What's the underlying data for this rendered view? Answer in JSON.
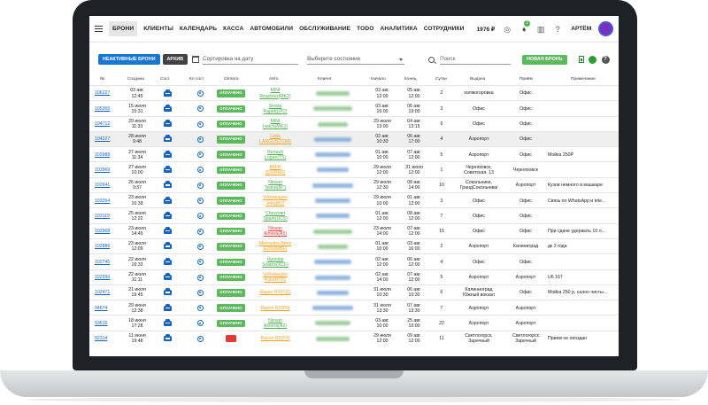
{
  "nav": {
    "items": [
      "БРОНИ",
      "КЛИЕНТЫ",
      "КАЛЕНДАРЬ",
      "КАССА",
      "АВТОМОБИЛИ",
      "ОБСЛУЖИВАНИЕ",
      "TODO",
      "АНАЛИТИКА",
      "СОТРУДНИКИ"
    ],
    "balance": "1976 ₽",
    "notif_count": "2",
    "user": "АРТЁМ"
  },
  "toolbar": {
    "unpaid_label": "НЕАКТИВНЫЕ БРОНИ",
    "archive_label": "АРХИВ",
    "sort_placeholder": "Сортировка на дату",
    "state_placeholder": "Выберите состояние",
    "search_placeholder": "Поиск",
    "new_label": "НОВАЯ БРОНЬ"
  },
  "table": {
    "headers": [
      "№",
      "Создана",
      "Сост.",
      "Кл сост",
      "Оплата",
      "Авто",
      "Клиент",
      "Начало",
      "Конец",
      "Сутки",
      "Выдача",
      "Приём",
      "Примечание"
    ],
    "rows": [
      {
        "id": "106227",
        "created": [
          "03 авг.",
          "12:45"
        ],
        "pay": "ОПЛАЧЕНО",
        "pay_color": "green",
        "car": [
          "MINI",
          "Roadster(MK2)"
        ],
        "car_color": "#4caf50",
        "client_color": "green",
        "begin": [
          "03 авг.",
          "12:00"
        ],
        "end": [
          "05 авг.",
          "12:00"
        ],
        "days": "2",
        "out": [
          "холмогоровка"
        ],
        "in": [
          "Офис"
        ],
        "note": ""
      },
      {
        "id": "105355",
        "created": [
          "15 июля",
          "15:31"
        ],
        "pay": "ОПЛАЧЕНО",
        "pay_color": "green",
        "car": [
          "Skoda",
          "Rapid(UP2)"
        ],
        "car_color": "#4caf50",
        "client_color": "green",
        "begin": [
          "03 авг.",
          "16:00"
        ],
        "end": [
          "06 авг.",
          "19:00"
        ],
        "days": "3",
        "out": [
          "Офис"
        ],
        "in": [
          "Офис"
        ],
        "note": ""
      },
      {
        "id": "104712",
        "created": [
          "29 июля",
          "11:33"
        ],
        "pay": "ОПЛАЧЕНО",
        "pay_color": "green",
        "car": [
          "MINI",
          "Hatch(MK3)"
        ],
        "car_color": "#4caf50",
        "client_color": "green",
        "begin": [
          "29 июля",
          "13:00"
        ],
        "end": [
          "04 авг.",
          "13:15"
        ],
        "days": "6",
        "out": [
          "Офис"
        ],
        "in": [
          "Офис"
        ],
        "note": ""
      },
      {
        "id": "104227",
        "created": [
          "28 июля",
          "9:48"
        ],
        "pay": "ОПЛАЧЕНО",
        "pay_color": "green",
        "car": [
          "Lada",
          "LARGUS(TDM)"
        ],
        "car_color": "#f0a020",
        "client_color": "blue",
        "begin": [
          "02 авг.",
          "10:30"
        ],
        "end": [
          "06 авг.",
          "17:00"
        ],
        "days": "4",
        "out": [
          "Аэропорт"
        ],
        "in": [
          "Офис"
        ],
        "note": "",
        "hl": true
      },
      {
        "id": "103988",
        "created": [
          "27 июля",
          "11:34"
        ],
        "pay": "ОПЛАЧЕНО",
        "pay_color": "green",
        "car": [
          "Renault",
          "Logan(T5)"
        ],
        "car_color": "#4caf50",
        "client_color": "blue",
        "begin": [
          "01 авг.",
          "10:00"
        ],
        "end": [
          "07 авг.",
          "12:00"
        ],
        "days": "5",
        "out": [
          "Аэропорт"
        ],
        "in": [
          "Офис"
        ],
        "note": "Мойка 250Р"
      },
      {
        "id": "103969",
        "created": [
          "27 июля",
          "10:00"
        ],
        "pay": "ОПЛАЧЕНО",
        "pay_color": "green",
        "car": [
          "BMW",
          "316(BM3)"
        ],
        "car_color": "#f0a020",
        "client_color": "blue",
        "begin": [
          "29 июля",
          "12:00"
        ],
        "end": [
          "31 июля",
          "12:00"
        ],
        "days": "1",
        "out": [
          "Черняховск,",
          "Советская, 13"
        ],
        "in": [
          "Черняховск"
        ],
        "note": ""
      },
      {
        "id": "102641",
        "created": [
          "26 июля",
          "9:37"
        ],
        "pay": "ОПЛАЧЕНО",
        "pay_color": "green",
        "car": [
          "Nissan",
          "Teana(NT)"
        ],
        "car_color": "#4caf50",
        "client_color": "blue",
        "begin": [
          "29 июля",
          "12:30"
        ],
        "end": [
          "08 авг.",
          "14:00"
        ],
        "days": "10",
        "out": [
          "Сокольники,",
          "ГрандСокольники"
        ],
        "in": [
          "Аэропорт"
        ],
        "note": "Кузов немного в машкаре"
      },
      {
        "id": "103264",
        "created": [
          "23 июля",
          "16:39"
        ],
        "pay": "ОПЛАЧЕНО",
        "pay_color": "green",
        "car": [
          "Volkswagen",
          "Jetta(BZ)"
        ],
        "car_color": "#f0a020",
        "client_color": "blue",
        "begin": [
          "29 июля",
          "10:00"
        ],
        "end": [
          "01 авг.",
          "12:00"
        ],
        "days": "3",
        "out": [
          "Офис"
        ],
        "in": [
          "Офис"
        ],
        "note": "Связь по WhatsApp и tele..."
      },
      {
        "id": "103119",
        "created": [
          "25 июля",
          "12:22"
        ],
        "pay": "ОПЛАЧЕНО",
        "pay_color": "green",
        "car": [
          "Chevrolet",
          "Spark(UC5)"
        ],
        "car_color": "#4caf50",
        "client_color": "blue",
        "begin": [
          "01 авг.",
          "12:00"
        ],
        "end": [
          "08 авг.",
          "12:00"
        ],
        "days": "7",
        "out": [
          "Офис"
        ],
        "in": [
          "Офис"
        ],
        "note": ""
      },
      {
        "id": "102968",
        "created": [
          "23 июля",
          "14:49"
        ],
        "pay": "ОПЛАЧЕНО",
        "pay_color": "green",
        "car": [
          "Nissan",
          "Almera(A5)"
        ],
        "car_color": "#e53935",
        "client_color": "green",
        "begin": [
          "23 июля",
          "14:00"
        ],
        "end": [
          "07 авг.",
          "12:00"
        ],
        "days": "15",
        "out": [
          "Офис"
        ],
        "in": [
          "Офис"
        ],
        "note": "При сдаче удержать 10 л..."
      },
      {
        "id": "102886",
        "created": [
          "23 июля",
          "12:09"
        ],
        "pay": "ОПЛАЧЕНО",
        "pay_color": "green",
        "car": [
          "Mercedes-Benz",
          "E200(MBE)"
        ],
        "car_color": "#f0a020",
        "client_color": "green",
        "begin": [
          "01 авг.",
          "10:00"
        ],
        "end": [
          "03 авг.",
          "16:00"
        ],
        "days": "2",
        "out": [
          "Аэропорт"
        ],
        "in": [
          "Калиниград"
        ],
        "note": "дк 2 года"
      },
      {
        "id": "102745",
        "created": [
          "22 июля",
          "16:33"
        ],
        "pay": "ОПЛАЧЕНО",
        "pay_color": "green",
        "car": [
          "Hyundai",
          "Solaris(XCF)"
        ],
        "car_color": "#4caf50",
        "client_color": "blue",
        "begin": [
          "02 авг.",
          "12:00"
        ],
        "end": [
          "06 авг.",
          "12:00"
        ],
        "days": "4",
        "out": [
          "Офис"
        ],
        "in": [
          "Офис"
        ],
        "note": ""
      },
      {
        "id": "102550",
        "created": [
          "22 июля",
          "11:11"
        ],
        "pay": "ОПЛАЧЕНО",
        "pay_color": "green",
        "car": [
          "Volkswagen",
          "Polo(RTD)"
        ],
        "car_color": "#f0a020",
        "client_color": "blue",
        "begin": [
          "02 авг.",
          "14:00"
        ],
        "end": [
          "07 авг.",
          "12:00"
        ],
        "days": "5",
        "out": [
          "Аэропорт"
        ],
        "in": [
          "Аэропорт"
        ],
        "note": "U6 167"
      },
      {
        "id": "102471",
        "created": [
          "21 июля",
          "19:45"
        ],
        "pay": "ОПЛАЧЕНО",
        "pay_color": "green",
        "car": [
          "Ravon R2(P11)"
        ],
        "car_color": "#f0a020",
        "client_color": "blue",
        "begin": [
          "31 июля",
          "10:30"
        ],
        "end": [
          "06 авг.",
          "10:30"
        ],
        "days": "6",
        "out": [
          "Калининград",
          "Южный вокзал"
        ],
        "in": [
          "Офис"
        ],
        "note": "Мойка 250 р, салон чисты..."
      },
      {
        "id": "94674",
        "created": [
          "29 июня",
          "12:38"
        ],
        "pay": "ОПЛАЧЕНО",
        "pay_color": "green",
        "car": [
          "Ravon R2(P9)"
        ],
        "car_color": "#f0a020",
        "client_color": "blue",
        "begin": [
          "31 июля",
          "13:30"
        ],
        "end": [
          "07 авг.",
          "13:30"
        ],
        "days": "7",
        "out": [
          "Аэропорт"
        ],
        "in": [
          "Аэропорт"
        ],
        "note": ""
      },
      {
        "id": "93615",
        "created": [
          "18 июня",
          "17:28"
        ],
        "pay": "ОПЛАЧЕНО",
        "pay_color": "green",
        "car": [
          "Nissan",
          "Almera(A2)"
        ],
        "car_color": "#4caf50",
        "client_color": "green",
        "begin": [
          "03 авг.",
          "10:00"
        ],
        "end": [
          "25 авг.",
          "10:00"
        ],
        "days": "22",
        "out": [
          "Аэропорт"
        ],
        "in": [
          "Аэропорт"
        ],
        "note": ""
      },
      {
        "id": "92314",
        "created": [
          "11 июня",
          "19:48"
        ],
        "pay": "",
        "pay_color": "red",
        "car": [
          "Ravon R2(P3)"
        ],
        "car_color": "#f0a020",
        "client_color": "green",
        "begin": [
          "29 июля",
          "12:00"
        ],
        "end": [
          "09 авг.",
          "12:00"
        ],
        "days": "11",
        "out": [
          "Светлогорск,",
          "Заречный"
        ],
        "in": [
          "Светлогорск",
          "Заречный"
        ],
        "note": "Прием не опоздан"
      }
    ]
  }
}
